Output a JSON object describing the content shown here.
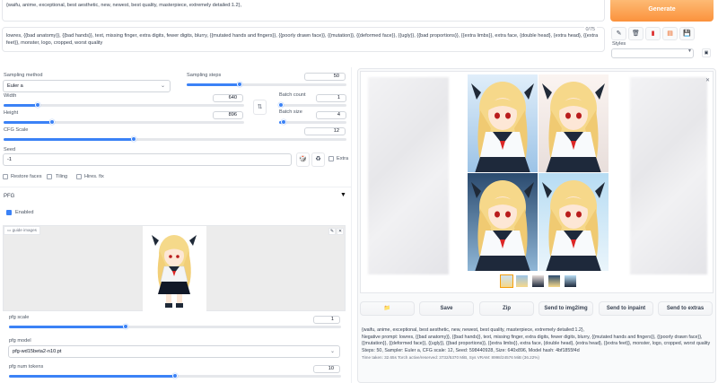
{
  "prompt": {
    "text": "{waifu, anime, exceptional, best aesthetic, new, newest, best quality, masterpiece, extremely detailed:1.2},",
    "negative_text": "lowres, {{bad anatomy}}, {{bad hands}}, text, missing finger, extra digits, fewer digits, blurry, {{mutated hands and fingers}}, {{poorly drawn face}}, {{mutation}}, {{deformed face}}, {{ugly}}, {{bad proportions}}, {{extra limbs}}, extra face, {double head}, {extra head}, {{extra feet}}, monster, logo, cropped, worst quality",
    "token_count": "0/75"
  },
  "generate": {
    "label": "Generate"
  },
  "tools": {
    "styles_label": "Styles",
    "icons": [
      "pencil-icon",
      "trash-icon",
      "book-icon",
      "clipboard-icon",
      "save-icon"
    ]
  },
  "settings": {
    "sampling_method_label": "Sampling method",
    "sampling_method_value": "Euler a",
    "sampling_steps_label": "Sampling steps",
    "sampling_steps_value": "50",
    "sampling_steps_fraction": 0.33,
    "width_label": "Width",
    "width_value": "640",
    "width_fraction": 0.14,
    "height_label": "Height",
    "height_value": "896",
    "height_fraction": 0.2,
    "batch_count_label": "Batch count",
    "batch_count_value": "1",
    "batch_count_fraction": 0.02,
    "batch_size_label": "Batch size",
    "batch_size_value": "4",
    "batch_size_fraction": 0.07,
    "cfg_label": "CFG Scale",
    "cfg_value": "12",
    "cfg_fraction": 0.38,
    "seed_label": "Seed",
    "seed_value": "-1",
    "extra_label": "Extra",
    "restore_faces_label": "Restore faces",
    "tiling_label": "Tiling",
    "hires_label": "Hires. fix"
  },
  "pfg": {
    "title": "PFG",
    "enabled_label": "Enabled",
    "guide_label": "guide images",
    "scale_label": "pfg scale",
    "scale_value": "1",
    "scale_fraction": 0.35,
    "model_label": "pfg model",
    "model_value": "pfg-wd15beta2-n10.pt",
    "tokens_label": "pfg num tokens",
    "tokens_value": "10",
    "tokens_fraction": 0.5
  },
  "output": {
    "buttons": {
      "folder": "📁",
      "save": "Save",
      "zip": "Zip",
      "img2img": "Send to img2img",
      "inpaint": "Send to inpaint",
      "extras": "Send to extras"
    },
    "info_prompt": "{waifu, anime, exceptional, best aesthetic, new, newest, best quality, masterpiece, extremely detailed:1.2},",
    "info_negative": "Negative prompt: lowres, {{bad anatomy}}, {{bad hands}}, text, missing finger, extra digits, fewer digits, blurry, {{mutated hands and fingers}}, {{poorly drawn face}}, {{mutation}}, {{deformed face}}, {{ugly}}, {{bad proportions}}, {{extra limbs}}, extra face, {double head}, {extra head}, {{extra feet}}, monster, logo, cropped, worst quality",
    "info_params": "Steps: 50, Sampler: Euler a, CFG scale: 12, Seed: 598440928, Size: 640x896, Model hash: 4bf1855f4d",
    "info_time": "Time taken: 32.65s  Torch active/reserved: 3732/5370 MiB, Sys VRAM: 8998/24576 MiB (36.22%)"
  },
  "colors": {
    "generate_bg": "#fdba74",
    "accent": "#3b82f6"
  }
}
